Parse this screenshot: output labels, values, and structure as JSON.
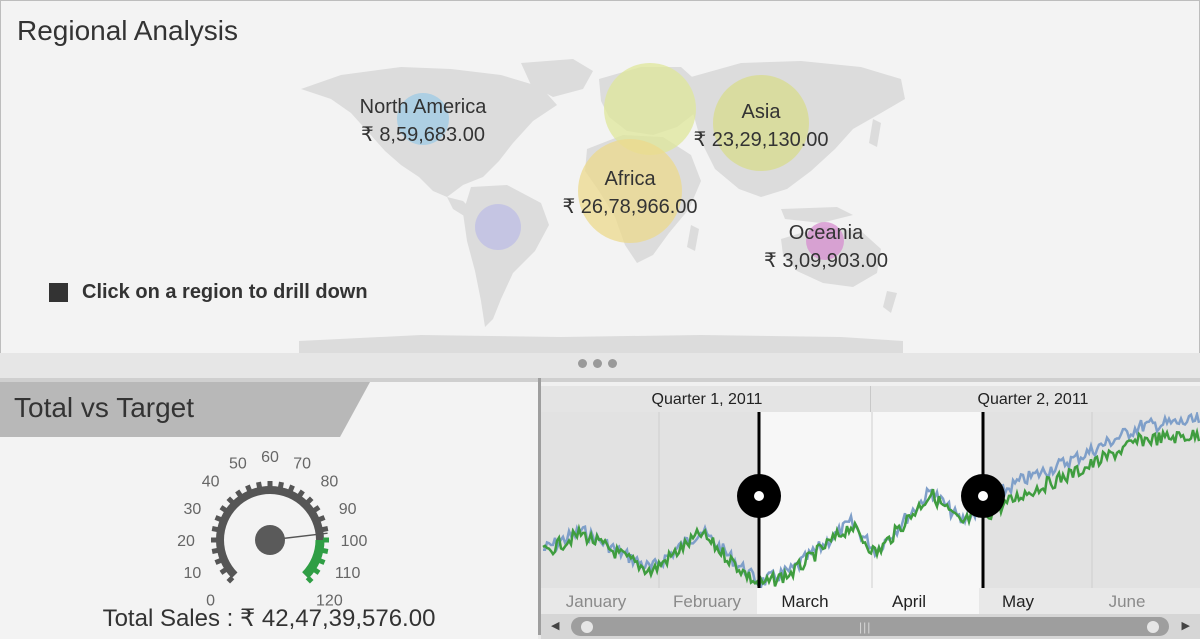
{
  "regional": {
    "title": "Regional Analysis",
    "hint": "Click on a region to drill down",
    "regions": [
      {
        "name": "North America",
        "value": "₹ 8,59,683.00",
        "color": "#9ecbe6"
      },
      {
        "name": "Africa",
        "value": "₹ 26,78,966.00",
        "color": "#ecd98c"
      },
      {
        "name": "Asia",
        "value": "₹ 23,29,130.00",
        "color": "#d8dc8c"
      },
      {
        "name": "Oceania",
        "value": "₹ 3,09,903.00",
        "color": "#d68ecf"
      }
    ],
    "unlabeled_bubbles": [
      {
        "region": "Europe",
        "color": "#dfe79a"
      },
      {
        "region": "South America",
        "color": "#bdbde6"
      }
    ]
  },
  "gauge_panel": {
    "title": "Total vs Target",
    "scale_labels": [
      "0",
      "10",
      "20",
      "30",
      "40",
      "50",
      "60",
      "70",
      "80",
      "90",
      "100",
      "110",
      "120"
    ],
    "total_sales_label": "Total Sales : ₹ 42,47,39,576.00",
    "needle_value": 97,
    "target_range": [
      100,
      120
    ],
    "colors": {
      "scale": "#555555",
      "target": "#2f9e44"
    }
  },
  "timeline": {
    "quarters": [
      "Quarter 1, 2011",
      "Quarter 2, 2011"
    ],
    "months": [
      "January",
      "February",
      "March",
      "April",
      "May",
      "June"
    ],
    "selected_months": [
      "March",
      "April",
      "May"
    ],
    "colors": {
      "series_blue": "#7f9fc9",
      "series_green": "#3f9d3f",
      "selection": "#000000"
    }
  },
  "icons": {
    "scroll_left": "scroll-left-icon",
    "scroll_right": "scroll-right-icon",
    "range_handle": "range-handle-icon"
  }
}
